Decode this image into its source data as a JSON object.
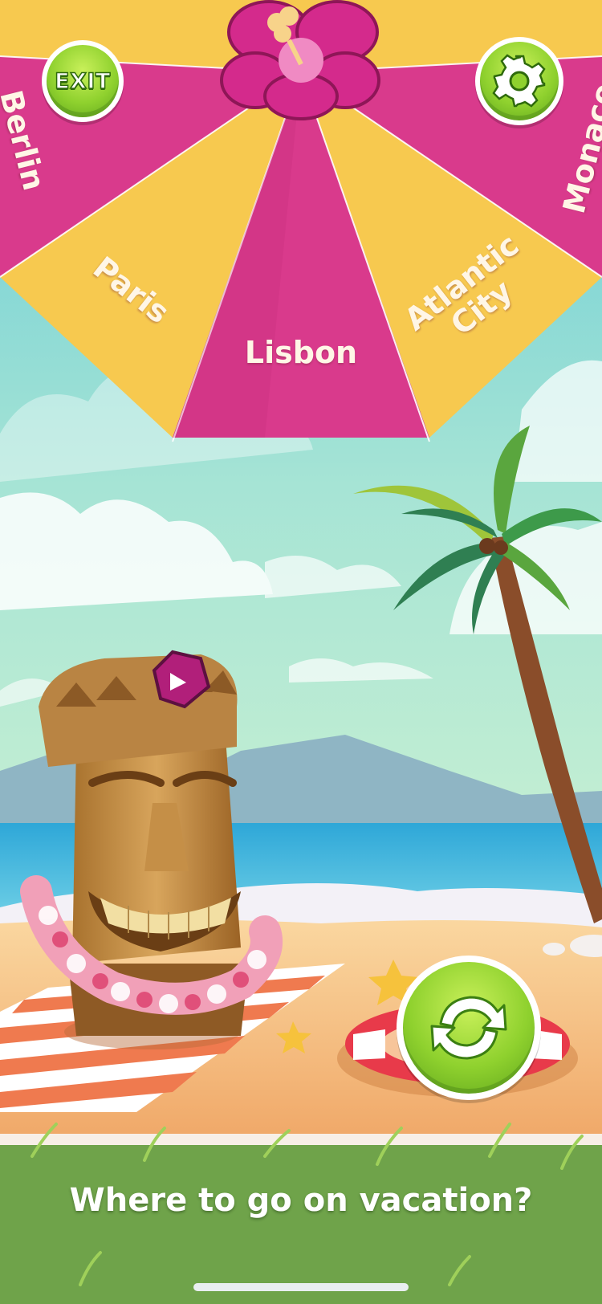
{
  "wheel": {
    "segments": [
      {
        "label": "Berlin",
        "color": "#d93a8c"
      },
      {
        "label": "Paris",
        "color": "#f7c94f"
      },
      {
        "label": "Lisbon",
        "color": "#d93a8c"
      },
      {
        "label": "Atlantic\nCity",
        "color": "#f7c94f"
      },
      {
        "label": "Monaco",
        "color": "#d93a8c"
      }
    ]
  },
  "exit_button": {
    "label": "EXIT",
    "icon": "exit-icon"
  },
  "settings_button": {
    "icon": "gear-icon"
  },
  "spin_button": {
    "icon": "refresh-icon"
  },
  "caption": "Where to go on vacation?",
  "colors": {
    "wheel_pink": "#d93a8c",
    "wheel_yellow": "#f7c94f",
    "button_green": "#8fd12e",
    "sky": "#7fd3d6",
    "sand": "#f6c381",
    "grass": "#6fa34a"
  }
}
